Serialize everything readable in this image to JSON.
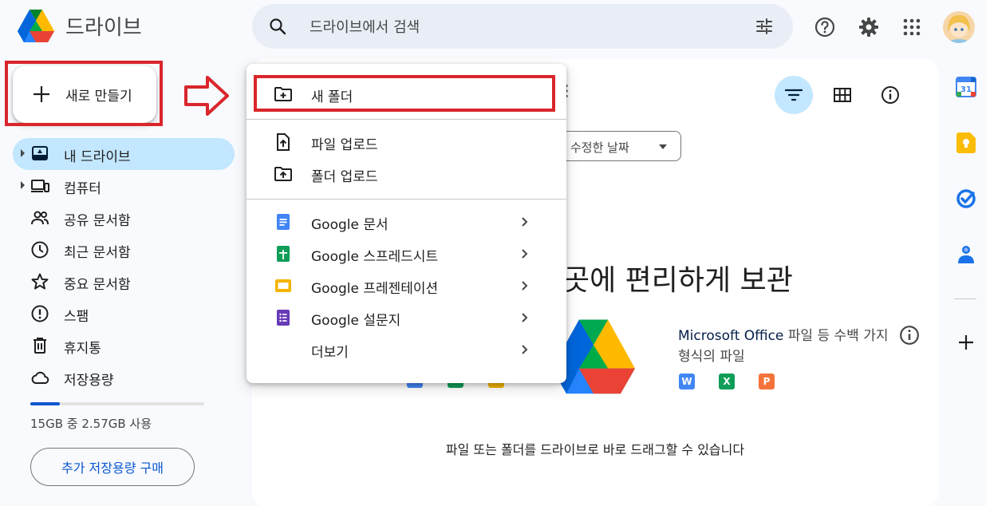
{
  "app": {
    "title": "드라이브"
  },
  "search": {
    "placeholder": "드라이브에서 검색"
  },
  "sidebar": {
    "new_label": "새로 만들기",
    "items": [
      {
        "label": "내 드라이브",
        "icon": "my-drive-icon",
        "active": true
      },
      {
        "label": "컴퓨터",
        "icon": "computer-icon"
      },
      {
        "label": "공유 문서함",
        "icon": "shared-people-icon"
      },
      {
        "label": "최근 문서함",
        "icon": "clock-icon"
      },
      {
        "label": "중요 문서함",
        "icon": "star-icon"
      },
      {
        "label": "스팸",
        "icon": "spam-icon"
      },
      {
        "label": "휴지통",
        "icon": "trash-icon"
      },
      {
        "label": "저장용량",
        "icon": "cloud-icon"
      }
    ],
    "storage": {
      "text": "15GB 중 2.57GB 사용",
      "used_fraction": 0.171
    },
    "buy_label": "추가 저장용량 구매"
  },
  "main": {
    "sort_chip": "수정한 날짜",
    "heading": "곳에 편리하게 보관",
    "promo": {
      "brand": "Microsoft Office",
      "text": " 파일 등 수백 가지 형식의 파일"
    },
    "office_icons": [
      {
        "letter": "W",
        "color": "#4285f4"
      },
      {
        "letter": "X",
        "color": "#0f9d58"
      },
      {
        "letter": "P",
        "color": "#f4733b"
      }
    ],
    "drop_message": "파일 또는 폴더를 드라이브로 바로 드래그할 수 있습니다"
  },
  "menu": {
    "new_folder": "새 폴더",
    "file_upload": "파일 업로드",
    "folder_upload": "폴더 업로드",
    "docs": "Google 문서",
    "sheets": "Google 스프레드시트",
    "slides": "Google 프레젠테이션",
    "forms": "Google 설문지",
    "more": "더보기"
  },
  "colors": {
    "accent": "#0b57d0",
    "active_nav": "#c2e7ff",
    "highlight_red": "#d9262b",
    "docs": "#4285f4",
    "sheets": "#0f9d58",
    "slides": "#f4b400",
    "forms": "#673ab7"
  }
}
